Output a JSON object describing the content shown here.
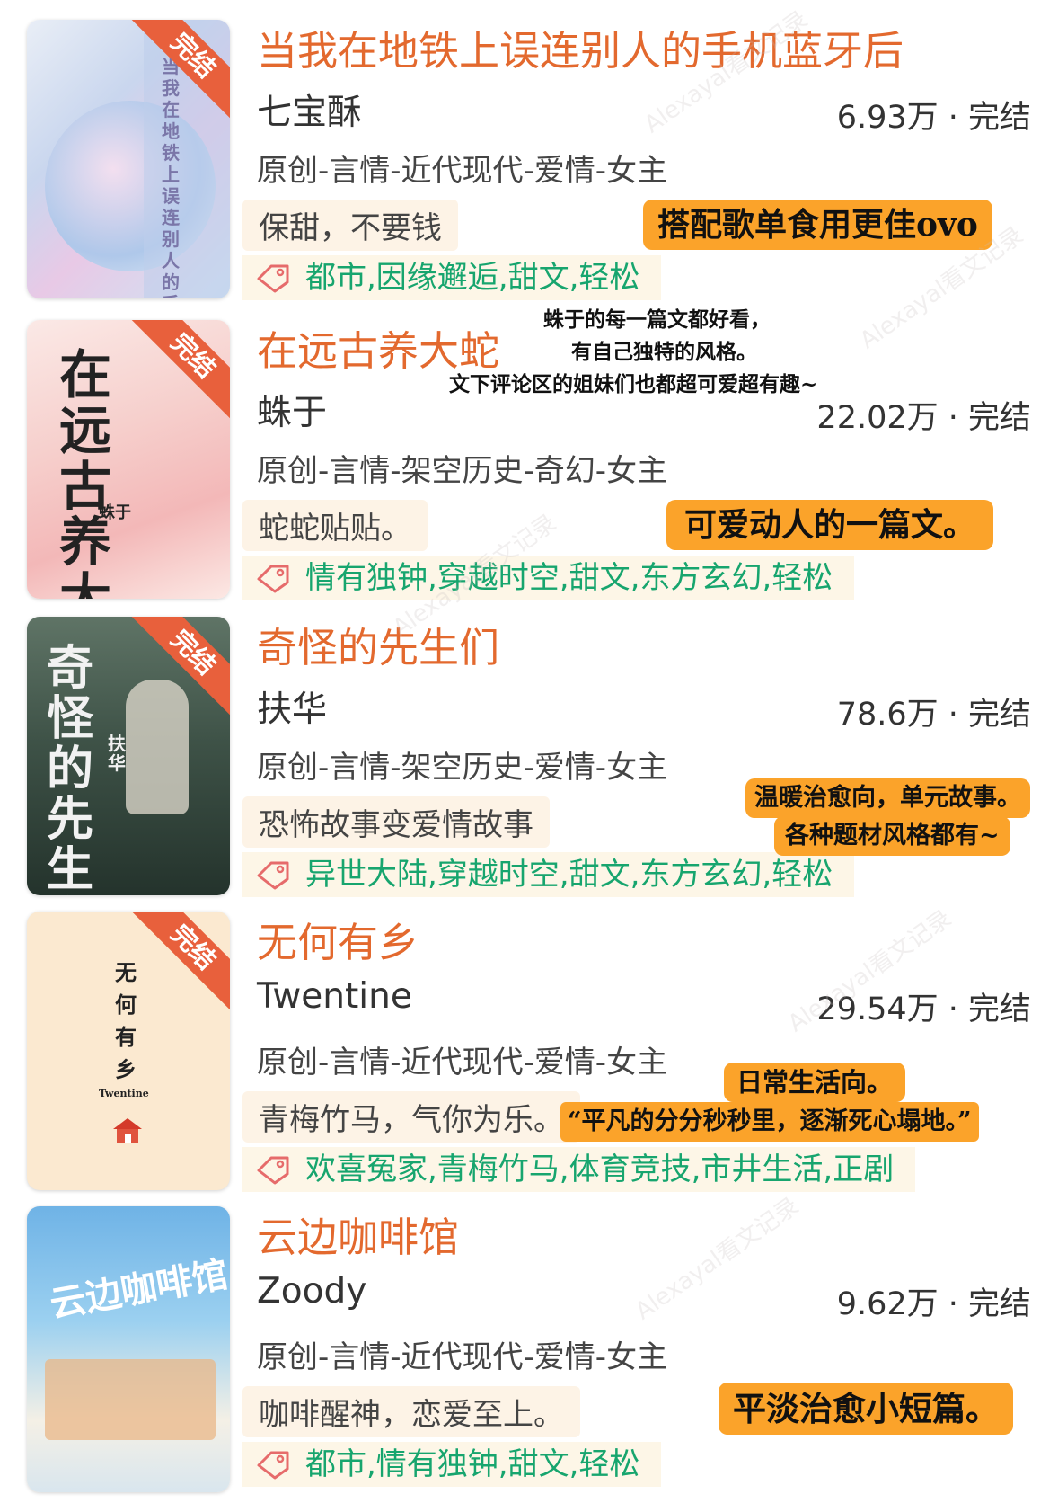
{
  "books": [
    {
      "title": "当我在地铁上误连别人的手机蓝牙后",
      "author": "七宝酥",
      "meta": "6.93万 · 完结",
      "genre": "原创-言情-近代现代-爱情-女主",
      "tagline": "保甜，不要钱",
      "tags": "都市,因缘邂逅,甜文,轻松",
      "ribbon": "完结",
      "cover_text": "当我在地铁上误连别人的手机蓝牙后",
      "note": "搭配歌单食用更佳ovo"
    },
    {
      "title": "在远古养大蛇",
      "author": "蛛于",
      "meta": "22.02万 · 完结",
      "genre": "原创-言情-架空历史-奇幻-女主",
      "tagline": "蛇蛇贴贴。",
      "tags": "情有独钟,穿越时空,甜文,东方玄幻,轻松",
      "ribbon": "完结",
      "cover_text": "在远古养大蛇",
      "cover_author": "蛛于",
      "note": "可爱动人的一篇文。",
      "note_extra": [
        "蛛于的每一篇文都好看，",
        "有自己独特的风格。",
        "文下评论区的姐妹们也都超可爱超有趣~"
      ]
    },
    {
      "title": "奇怪的先生们",
      "author": "扶华",
      "meta": "78.6万 · 完结",
      "genre": "原创-言情-架空历史-爱情-女主",
      "tagline": "恐怖故事变爱情故事",
      "tags": "异世大陆,穿越时空,甜文,东方玄幻,轻松",
      "ribbon": "完结",
      "cover_text": "奇怪的先生们",
      "cover_author": "扶华",
      "note_lines": [
        "温暖治愈向，单元故事。",
        "各种题材风格都有~"
      ]
    },
    {
      "title": "无何有乡",
      "author": "Twentine",
      "meta": "29.54万 · 完结",
      "genre": "原创-言情-近代现代-爱情-女主",
      "tagline": "青梅竹马，气你为乐。",
      "tags": "欢喜冤家,青梅竹马,体育竞技,市井生活,正剧",
      "ribbon": "完结",
      "cover_text": "无何有乡",
      "cover_author": "Twentine",
      "note_top": "日常生活向。",
      "note_quote": "“平凡的分分秒秒里，逐渐死心塌地。”"
    },
    {
      "title": "云边咖啡馆",
      "author": "Zoody",
      "meta": "9.62万 · 完结",
      "genre": "原创-言情-近代现代-爱情-女主",
      "tagline": "咖啡醒神，恋爱至上。",
      "tags": "都市,情有独钟,甜文,轻松",
      "ribbon": "完结",
      "cover_text": "云边咖啡馆",
      "note": "平淡治愈小短篇。"
    }
  ],
  "watermark": "Alexayal看文记录",
  "colors": {
    "title": "#e3692e",
    "tag": "#17a56e",
    "note_bg": "#fba32a",
    "ribbon": "#e8603c"
  }
}
